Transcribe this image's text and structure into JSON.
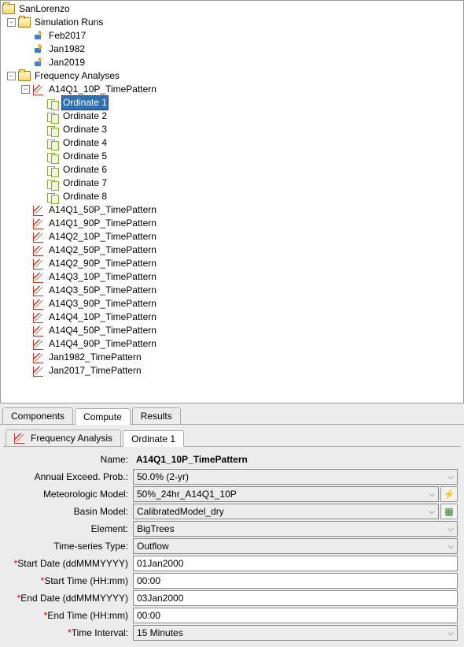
{
  "tree": {
    "root": "SanLorenzo",
    "sim_folder": "Simulation Runs",
    "sims": [
      "Feb2017",
      "Jan1982",
      "Jan2019"
    ],
    "fa_folder": "Frequency Analyses",
    "fa_expanded": "A14Q1_10P_TimePattern",
    "ordinate_prefix": "Ordinate",
    "ordinates": [
      "Ordinate 1",
      "Ordinate 2",
      "Ordinate 3",
      "Ordinate 4",
      "Ordinate 5",
      "Ordinate 6",
      "Ordinate 7",
      "Ordinate 8"
    ],
    "fa_rest": [
      "A14Q1_50P_TimePattern",
      "A14Q1_90P_TimePattern",
      "A14Q2_10P_TimePattern",
      "A14Q2_50P_TimePattern",
      "A14Q2_90P_TimePattern",
      "A14Q3_10P_TimePattern",
      "A14Q3_50P_TimePattern",
      "A14Q3_90P_TimePattern",
      "A14Q4_10P_TimePattern",
      "A14Q4_50P_TimePattern",
      "A14Q4_90P_TimePattern",
      "Jan1982_TimePattern",
      "Jan2017_TimePattern"
    ]
  },
  "tabs": {
    "main": [
      "Components",
      "Compute",
      "Results"
    ],
    "active": "Compute"
  },
  "subtabs": {
    "items": [
      "Frequency Analysis",
      "Ordinate 1"
    ],
    "active": "Ordinate 1"
  },
  "form": {
    "name_label": "Name:",
    "name_value": "A14Q1_10P_TimePattern",
    "aep_label": "Annual Exceed. Prob.:",
    "aep_value": "50.0% (2-yr)",
    "met_label": "Meteorologic Model:",
    "met_value": "50%_24hr_A14Q1_10P",
    "basin_label": "Basin Model:",
    "basin_value": "CalibratedModel_dry",
    "elem_label": "Element:",
    "elem_value": "BigTrees",
    "ts_label": "Time-series Type:",
    "ts_value": "Outflow",
    "sd_label": "Start Date (ddMMMYYYY)",
    "sd_value": "01Jan2000",
    "st_label": "Start Time (HH:mm)",
    "st_value": "00:00",
    "ed_label": "End Date (ddMMMYYYY)",
    "ed_value": "03Jan2000",
    "et_label": "End Time (HH:mm)",
    "et_value": "00:00",
    "ti_label": "Time Interval:",
    "ti_value": "15 Minutes"
  }
}
